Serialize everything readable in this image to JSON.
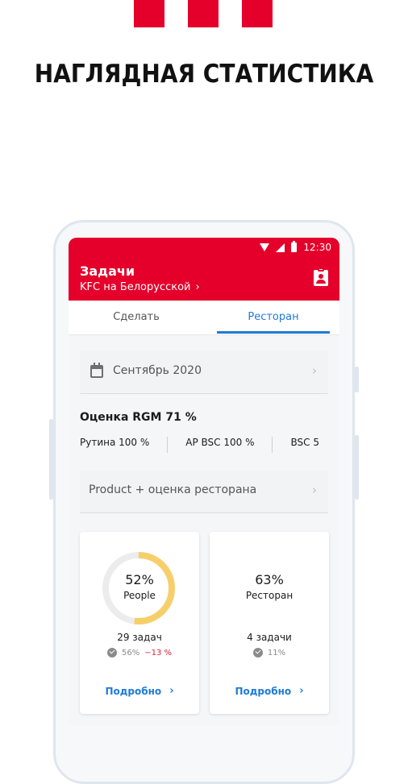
{
  "headline": "НАГЛЯДНАЯ СТАТИСТИКА",
  "colors": {
    "brand_red": "#e4002b",
    "accent_blue": "#1f7ad6",
    "ring_gold": "#f7cf6a",
    "negative": "#d62435"
  },
  "status_bar": {
    "time": "12:30",
    "icons": [
      "wifi-icon",
      "signal-icon",
      "battery-icon"
    ]
  },
  "app_bar": {
    "title": "Задачи",
    "subtitle": "KFC на Белорусской",
    "subtitle_chevron": "›",
    "action_icon": "clipboard-user-icon"
  },
  "tabs": [
    {
      "label": "Сделать",
      "active": false
    },
    {
      "label": "Ресторан",
      "active": true
    }
  ],
  "month_selector": {
    "label": "Сентябрь 2020",
    "icon": "calendar-icon",
    "chevron": "›"
  },
  "rgm": {
    "title": "Оценка RGM  71 %",
    "metrics": [
      "Рутина 100 %",
      "AP BSC 100 %",
      "BSC 5"
    ]
  },
  "product_selector": {
    "label": "Product + оценка ресторана",
    "chevron": "›"
  },
  "cards": [
    {
      "percent": "52%",
      "percent_value": 0.52,
      "name": "People",
      "tasks": "29 задач",
      "prev": "56%",
      "delta": "−13 %",
      "link": "Подробно",
      "link_chevron": "›"
    },
    {
      "percent": "63%",
      "percent_value": 0.63,
      "name": "Ресторан",
      "tasks": "4 задачи",
      "prev": "11%",
      "delta": "",
      "link": "Подробно",
      "link_chevron": "›"
    }
  ]
}
